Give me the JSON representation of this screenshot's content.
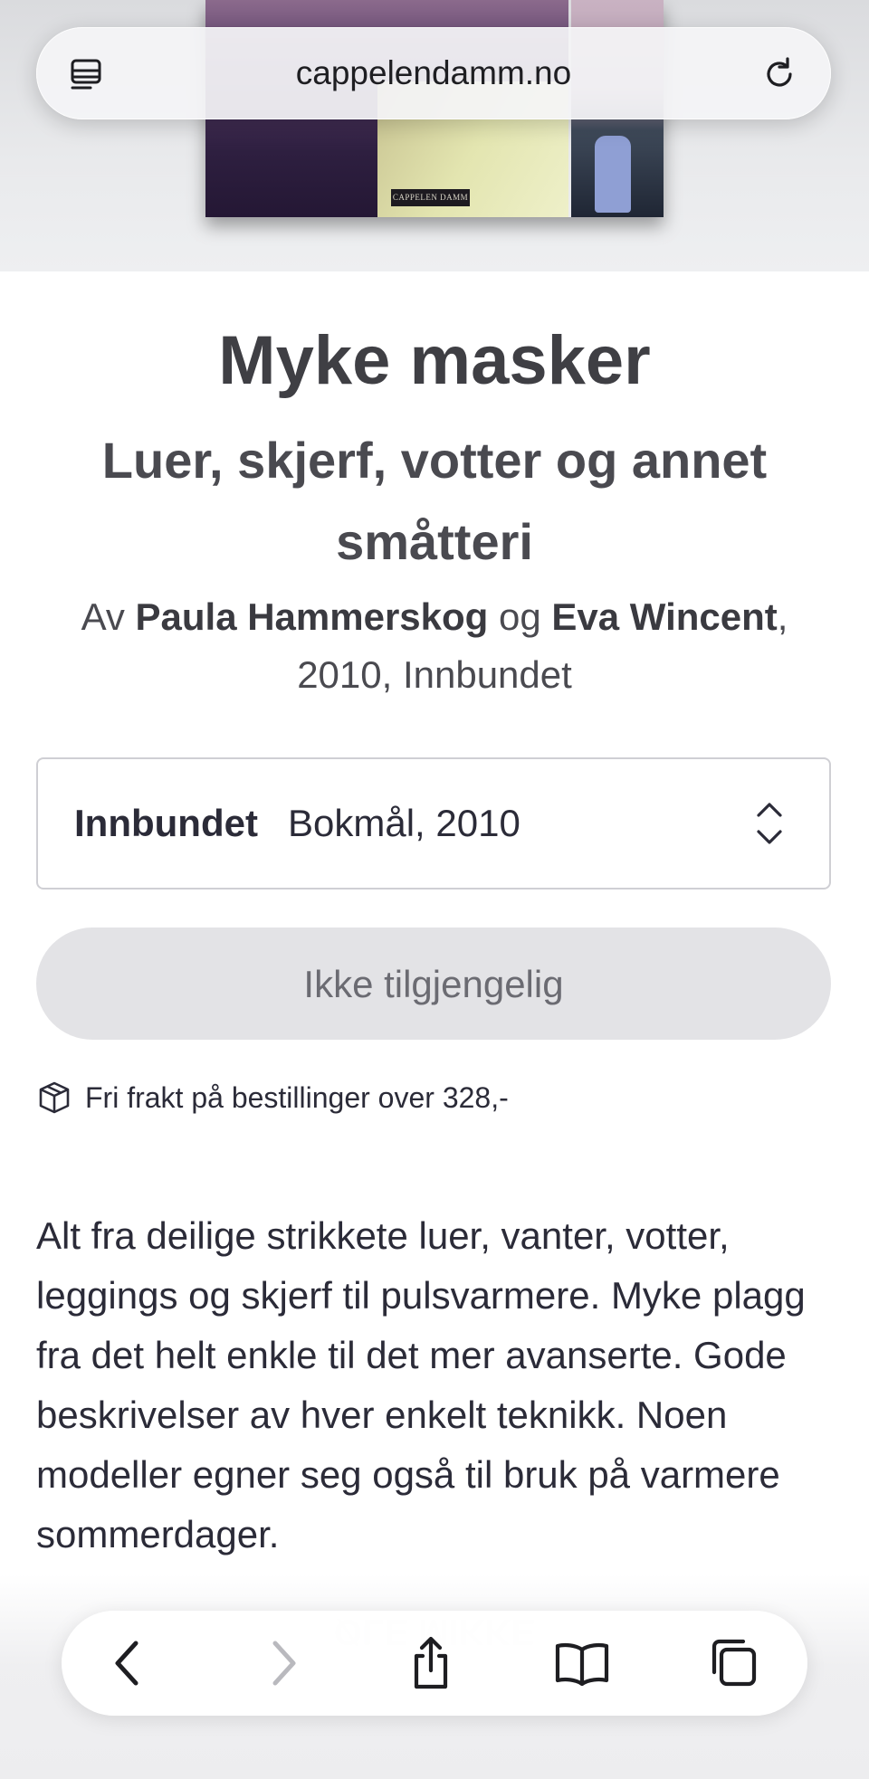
{
  "browser": {
    "url": "cappelendamm.no",
    "reader_icon": "reader-view-icon",
    "reload_icon": "reload-icon"
  },
  "cover": {
    "brand_text": "CAPPELEN DAMM"
  },
  "product": {
    "title": "Myke masker",
    "subtitle": "Luer, skjerf, votter og annet småtteri",
    "byline": {
      "prefix": "Av",
      "author1": "Paula Hammerskog",
      "conjunction": "og",
      "author2": "Eva Wincent",
      "details": "2010, Innbundet"
    }
  },
  "format_selector": {
    "format": "Innbundet",
    "detail": "Bokmål, 2010",
    "icon": "chevron-up-down-icon"
  },
  "availability_button": {
    "label": "Ikke tilgjengelig"
  },
  "shipping": {
    "icon": "package-icon",
    "text": "Fri frakt på bestillinger over 328,-"
  },
  "description": "Alt fra deilige strikkete luer, vanter, votter, leggings og skjerf til pulsvarmere. Myke plagg fra det helt enkle til det mer avanserte. Gode beskrivelser av hver enkelt teknikk. Noen modeller egner seg også til bruk på varmere sommerdager.",
  "toolbar": {
    "buttons": [
      "back-icon",
      "forward-icon",
      "share-icon",
      "bookmarks-icon",
      "tabs-icon"
    ]
  }
}
